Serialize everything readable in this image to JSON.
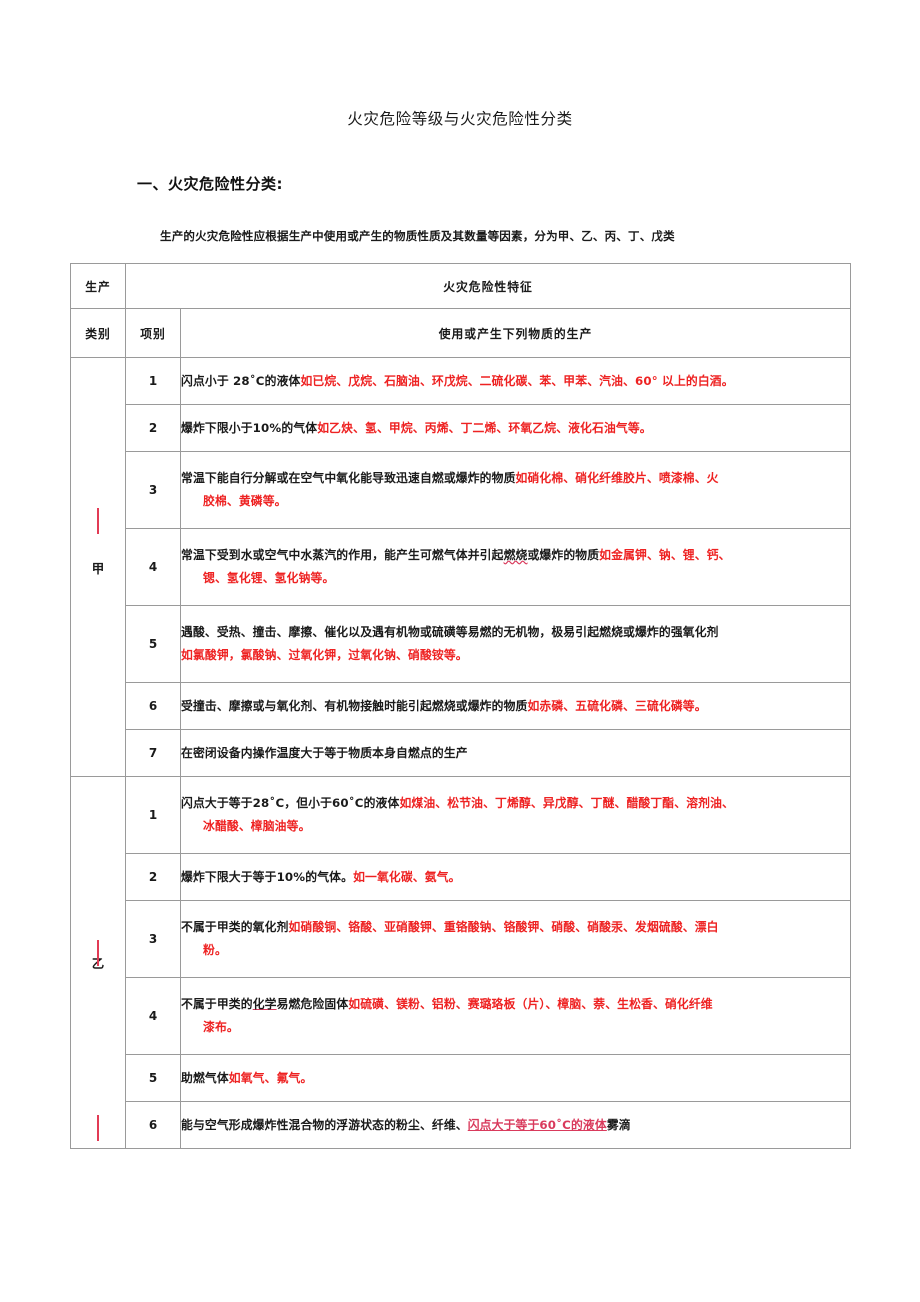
{
  "document": {
    "title": "火灾危险等级与火灾危险性分类",
    "section_heading": "一、火灾危险性分类:",
    "intro": "生产的火灾危险性应根据生产中使用或产生的物质性质及其数量等因素，分为甲、乙、丙、丁、戊类"
  },
  "table": {
    "headers": {
      "category_top": "生产",
      "category_bottom": "类别",
      "item": "项别",
      "feature_top": "火灾危险性特征",
      "feature_bottom": "使用或产生下列物质的生产"
    },
    "colors": {
      "red_text": "#ee2222",
      "underline_red": "#d93a5c",
      "border": "#9a9a9a",
      "text": "#1a1a1a"
    },
    "groups": [
      {
        "category": "甲",
        "items": [
          "1",
          "2",
          "3",
          "4",
          "5",
          "6",
          "7"
        ],
        "rows": [
          {
            "id": "jia-1",
            "lines": [
              [
                {
                  "t": "闪点小于 28˚C的液体",
                  "s": "black"
                },
                {
                  "t": "如已烷、戊烷、石脑油、环戊烷、二硫化碳、苯、甲苯、汽油、60° 以上的白酒。",
                  "s": "red"
                }
              ]
            ]
          },
          {
            "id": "jia-2",
            "lines": [
              [
                {
                  "t": "爆炸下限小于10%的气体",
                  "s": "black"
                },
                {
                  "t": "如乙炔、氢、甲烷、丙烯、丁二烯、环氧乙烷、液化石油气等。",
                  "s": "red"
                }
              ]
            ]
          },
          {
            "id": "jia-3",
            "lines": [
              [
                {
                  "t": "常温下能自行分解或在空气中氧化能导致迅速自燃或爆炸的物质",
                  "s": "black"
                },
                {
                  "t": "如硝化棉、硝化纤维胶片、喷漆棉、火",
                  "s": "red"
                }
              ],
              [
                {
                  "t": "胶棉、黄磷等。",
                  "s": "red-indent"
                }
              ]
            ]
          },
          {
            "id": "jia-4",
            "lines": [
              [
                {
                  "t": "常温下受到水或空气中水蒸汽的作用，能产生可燃气体并引起",
                  "s": "black"
                },
                {
                  "t": "燃烧",
                  "s": "black-wavy"
                },
                {
                  "t": "或爆炸的物质",
                  "s": "black"
                },
                {
                  "t": "如金属钾、钠、锂、钙、",
                  "s": "red"
                }
              ],
              [
                {
                  "t": "锶、氢化锂、氢化钠等。",
                  "s": "red-indent"
                }
              ]
            ]
          },
          {
            "id": "jia-5",
            "lines": [
              [
                {
                  "t": "遇酸、受热、撞击、摩擦、催化以及遇有机物或硫磺等易燃的无机物，极易引起燃烧或爆炸的强氧化剂",
                  "s": "black"
                }
              ],
              [
                {
                  "t": "如氯酸钾，氯酸钠、过氧化钾，过氧化钠、硝酸铵等。",
                  "s": "red"
                }
              ]
            ]
          },
          {
            "id": "jia-6",
            "lines": [
              [
                {
                  "t": "受撞击、摩擦或与氧化剂、有机物接触时能引起燃烧或爆炸的物质",
                  "s": "black"
                },
                {
                  "t": "如赤磷、五硫化磷、三硫化磷等。",
                  "s": "red"
                }
              ]
            ]
          },
          {
            "id": "jia-7",
            "lines": [
              [
                {
                  "t": "在密闭设备内操作温度大于等于物质本身自燃点的生产",
                  "s": "black"
                }
              ]
            ]
          }
        ]
      },
      {
        "category": "乙",
        "items": [
          "1",
          "2",
          "3",
          "4",
          "5",
          "6"
        ],
        "rows": [
          {
            "id": "yi-1",
            "lines": [
              [
                {
                  "t": "闪点大于等于28˚C，但小于60˚C的液体",
                  "s": "black"
                },
                {
                  "t": "如煤油、松节油、丁烯醇、异戊醇、丁醚、醋酸丁酯、溶剂油、",
                  "s": "red"
                }
              ],
              [
                {
                  "t": "冰醋酸、樟脑油等。",
                  "s": "red-indent"
                }
              ]
            ]
          },
          {
            "id": "yi-2",
            "lines": [
              [
                {
                  "t": "爆炸下限大于等于10%的气体。",
                  "s": "black"
                },
                {
                  "t": "如一氧化碳、氨气。",
                  "s": "red"
                }
              ]
            ]
          },
          {
            "id": "yi-3",
            "lines": [
              [
                {
                  "t": "不属于甲类的氧化剂",
                  "s": "black"
                },
                {
                  "t": "如硝酸铜、铬酸、亚硝酸钾、重铬酸钠、铬酸钾、硝酸、硝酸汞、发烟硫酸、漂白",
                  "s": "red"
                }
              ],
              [
                {
                  "t": "粉。",
                  "s": "red-indent"
                }
              ]
            ]
          },
          {
            "id": "yi-4",
            "lines": [
              [
                {
                  "t": "不属于甲类的",
                  "s": "black"
                },
                {
                  "t": "化学",
                  "s": "black-underline"
                },
                {
                  "t": "易燃危险固体",
                  "s": "black"
                },
                {
                  "t": "如硫磺、镁粉、铝粉、赛璐珞板（片）、樟脑、萘、生松香、硝化纤维",
                  "s": "red"
                }
              ],
              [
                {
                  "t": "漆布。",
                  "s": "red-indent"
                }
              ]
            ]
          },
          {
            "id": "yi-5",
            "lines": [
              [
                {
                  "t": "助燃气体",
                  "s": "black"
                },
                {
                  "t": "如氧气、氟气。",
                  "s": "red"
                }
              ]
            ]
          },
          {
            "id": "yi-6",
            "lines": [
              [
                {
                  "t": "能与空气形成爆炸性混合物的浮游状态的粉尘、纤维、",
                  "s": "black"
                },
                {
                  "t": "闪点大于等于60˚C的液体",
                  "s": "red-underline"
                },
                {
                  "t": "雾滴",
                  "s": "black"
                }
              ]
            ]
          }
        ]
      }
    ]
  }
}
